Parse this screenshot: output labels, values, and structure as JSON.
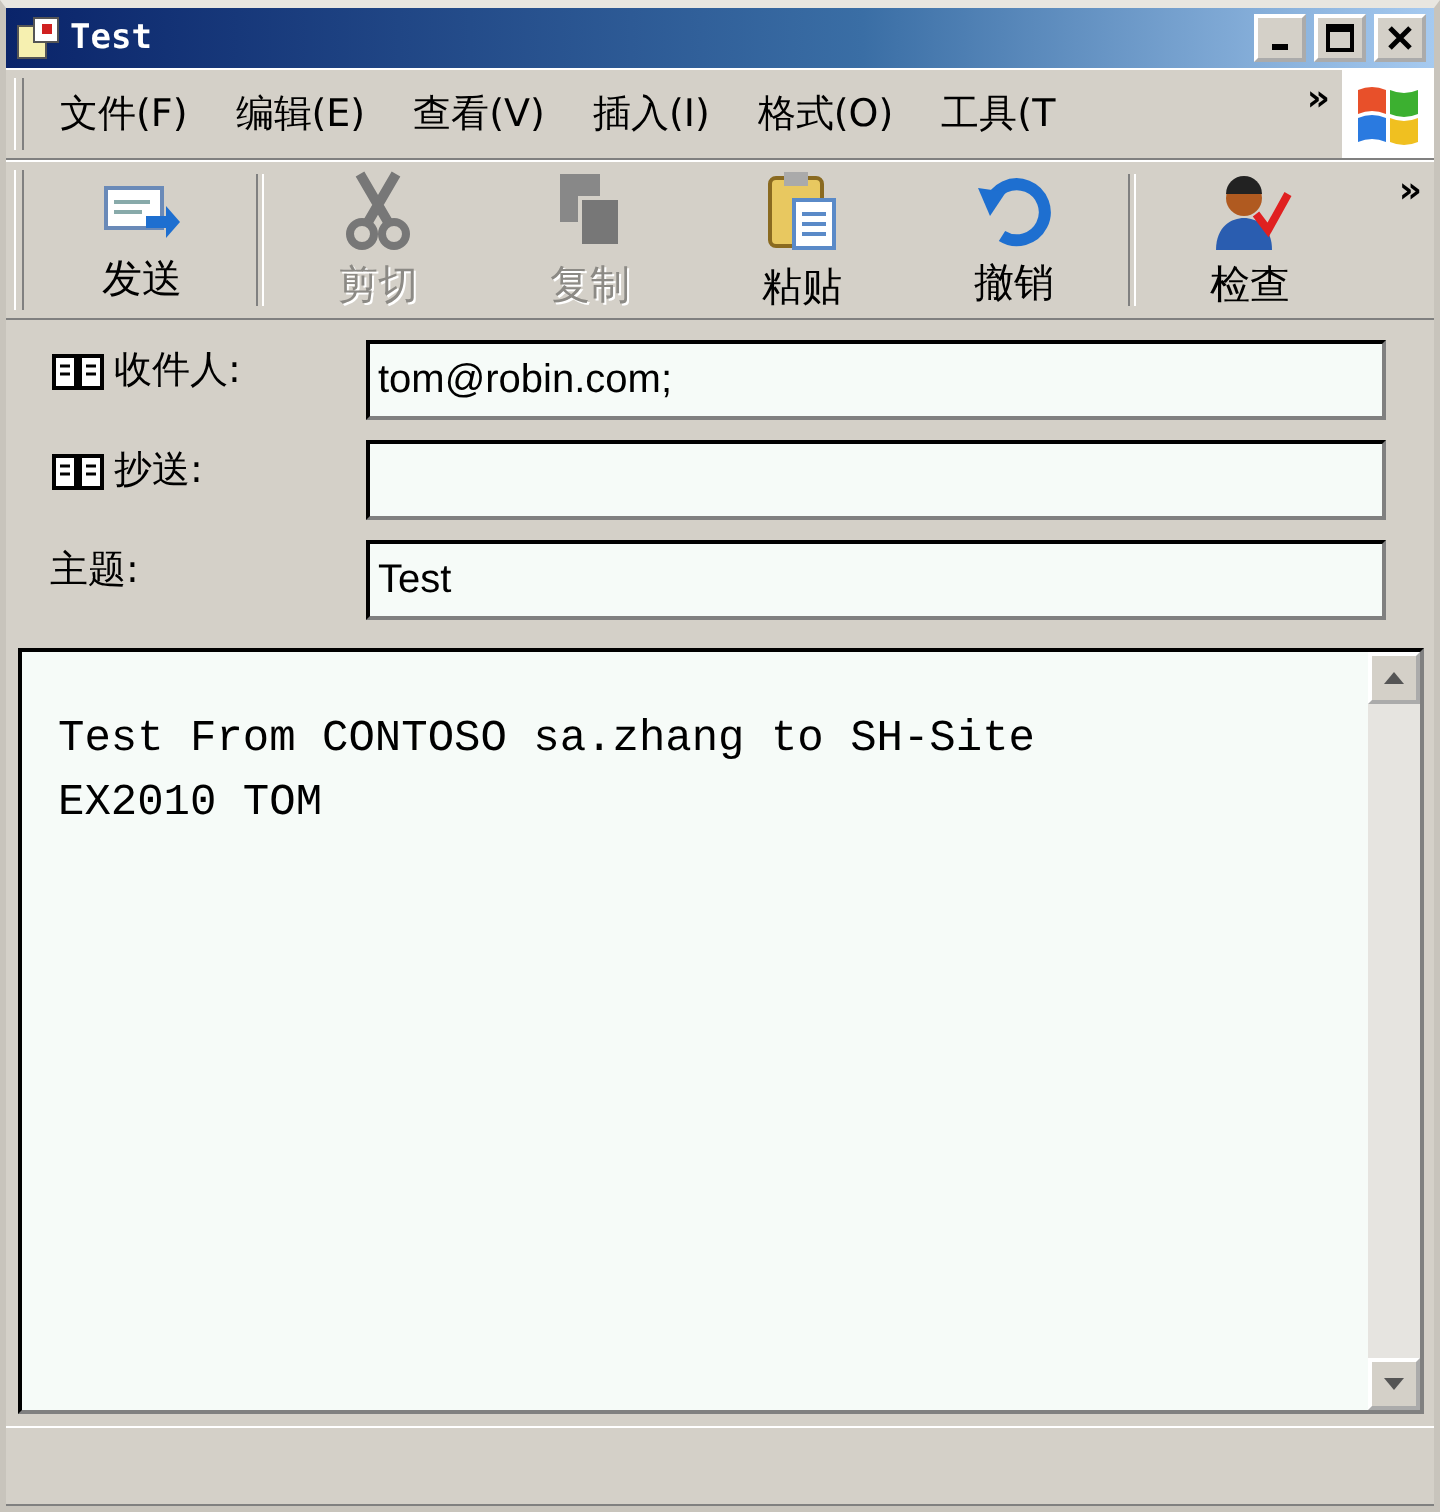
{
  "window": {
    "title": "Test"
  },
  "menu": [
    {
      "label": "文件(F)"
    },
    {
      "label": "编辑(E)"
    },
    {
      "label": "查看(V)"
    },
    {
      "label": "插入(I)"
    },
    {
      "label": "格式(O)"
    },
    {
      "label": "工具(T"
    }
  ],
  "menu_overflow": "»",
  "toolbar": {
    "buttons": [
      {
        "kind": "send",
        "label": "发送",
        "disabled": false
      },
      {
        "kind": "cut",
        "label": "剪切",
        "disabled": true
      },
      {
        "kind": "copy",
        "label": "复制",
        "disabled": true
      },
      {
        "kind": "paste",
        "label": "粘贴",
        "disabled": false
      },
      {
        "kind": "undo",
        "label": "撤销",
        "disabled": false
      },
      {
        "kind": "check",
        "label": "检查",
        "disabled": false
      }
    ],
    "overflow": "»"
  },
  "fields": [
    {
      "label": "收件人:",
      "address_book": true,
      "value": "tom@robin.com;"
    },
    {
      "label": "抄送:",
      "address_book": true
    },
    {
      "label": "主题:",
      "address_book": false,
      "value": "Test"
    }
  ],
  "body": {
    "lines": [
      "Test From CONTOSO sa.zhang to SH-Site",
      "EX2010 TOM"
    ]
  }
}
